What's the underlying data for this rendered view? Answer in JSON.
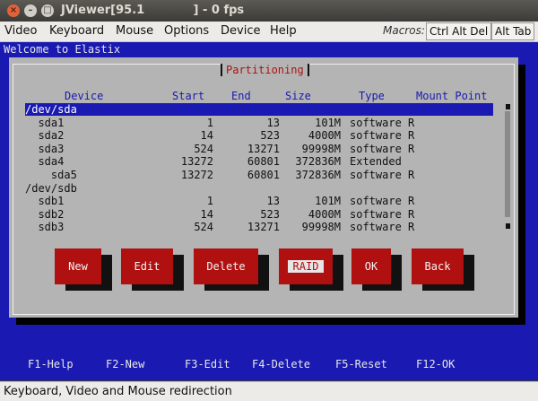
{
  "window": {
    "title": "JViewer[95.1            ] - 0 fps"
  },
  "menubar": {
    "items": [
      {
        "label": "Video"
      },
      {
        "label": "Keyboard"
      },
      {
        "label": "Mouse"
      },
      {
        "label": "Options"
      },
      {
        "label": "Device"
      },
      {
        "label": "Help"
      }
    ],
    "macros_label": "Macros:",
    "macro_buttons": [
      "Ctrl Alt Del",
      "Alt Tab"
    ]
  },
  "console": {
    "welcome": "Welcome to Elastix",
    "dialog_title": "Partitioning",
    "headers": [
      "Device",
      "Start",
      "End",
      "Size",
      "Type",
      "Mount Point"
    ],
    "rows": [
      {
        "device": "/dev/sda",
        "start": "",
        "end": "",
        "size": "",
        "type": "",
        "selected": true
      },
      {
        "device": "  sda1",
        "start": "1",
        "end": "13",
        "size": "101M",
        "type": "software R"
      },
      {
        "device": "  sda2",
        "start": "14",
        "end": "523",
        "size": "4000M",
        "type": "software R"
      },
      {
        "device": "  sda3",
        "start": "524",
        "end": "13271",
        "size": "99998M",
        "type": "software R"
      },
      {
        "device": "  sda4",
        "start": "13272",
        "end": "60801",
        "size": "372836M",
        "type": "Extended"
      },
      {
        "device": "    sda5",
        "start": "13272",
        "end": "60801",
        "size": "372836M",
        "type": "software R"
      },
      {
        "device": "/dev/sdb",
        "start": "",
        "end": "",
        "size": "",
        "type": ""
      },
      {
        "device": "  sdb1",
        "start": "1",
        "end": "13",
        "size": "101M",
        "type": "software R"
      },
      {
        "device": "  sdb2",
        "start": "14",
        "end": "523",
        "size": "4000M",
        "type": "software R"
      },
      {
        "device": "  sdb3",
        "start": "524",
        "end": "13271",
        "size": "99998M",
        "type": "software R"
      }
    ],
    "buttons": [
      "New",
      "Edit",
      "Delete",
      "RAID",
      "OK",
      "Back"
    ],
    "fkeys": [
      "F1-Help",
      "F2-New",
      "F3-Edit",
      "F4-Delete",
      "F5-Reset",
      "F12-OK"
    ]
  },
  "statusbar": {
    "text": "Keyboard, Video and Mouse redirection"
  },
  "colors": {
    "console_bg": "#1a1ab2",
    "dialog_bg": "#b4b4b4",
    "button_bg": "#b01010",
    "title_red": "#b01010"
  }
}
